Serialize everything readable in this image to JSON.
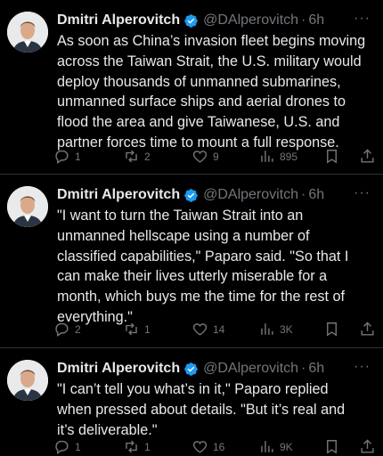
{
  "tweets": [
    {
      "name": "Dmitri Alperovitch",
      "handle": "@DAlperovitch",
      "separator": "·",
      "time": "6h",
      "more": "···",
      "text": "As soon as China’s invasion fleet begins moving\nacross the Taiwan Strait, the U.S. military would\ndeploy thousands of unmanned submarines,\nunmanned surface ships and aerial drones to\nflood the area and give Taiwanese, U.S. and\npartner forces time to mount a full response.",
      "replies": "1",
      "reposts": "2",
      "likes": "9",
      "views": "895"
    },
    {
      "name": "Dmitri Alperovitch",
      "handle": "@DAlperovitch",
      "separator": "·",
      "time": "6h",
      "more": "···",
      "text": "\"I want to turn the Taiwan Strait into an\nunmanned hellscape using a number of\nclassified capabilities,\" Paparo said. \"So that I\ncan make their lives utterly miserable for a\nmonth, which buys me the time for the rest of\neverything.\"",
      "replies": "2",
      "reposts": "1",
      "likes": "14",
      "views": "3K"
    },
    {
      "name": "Dmitri Alperovitch",
      "handle": "@DAlperovitch",
      "separator": "·",
      "time": "6h",
      "more": "···",
      "text": "\"I can’t tell you what’s in it,\" Paparo replied\nwhen pressed about details. \"But it’s real and\nit’s deliverable.\"",
      "replies": "1",
      "reposts": "1",
      "likes": "16",
      "views": "9K"
    }
  ],
  "colors": {
    "background": "#000000",
    "text": "#e7e9ea",
    "secondary": "#71767b",
    "verified": "#1d9bf0",
    "divider": "#2f3336"
  },
  "icons": [
    "verified-badge-icon",
    "reply-icon",
    "repost-icon",
    "like-icon",
    "views-icon",
    "bookmark-icon",
    "share-icon",
    "more-icon"
  ]
}
